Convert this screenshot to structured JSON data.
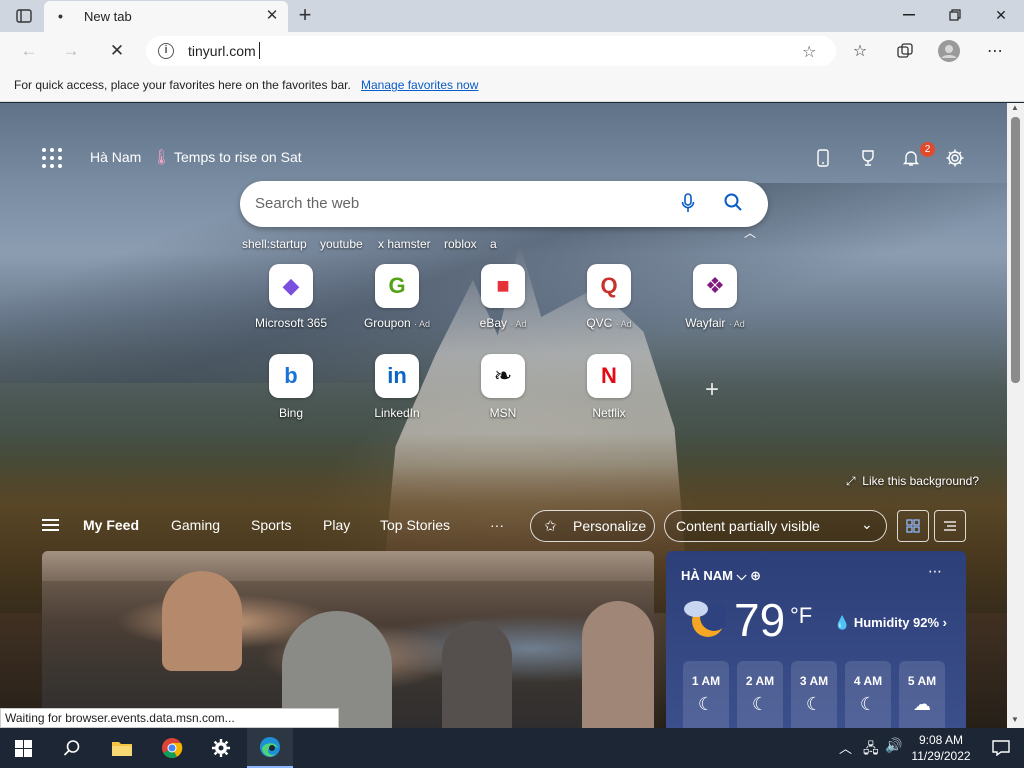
{
  "browser": {
    "tab_title": "New tab",
    "tab_favicon": "•",
    "new_tab_symbol": "+",
    "window_controls": [
      "minimize",
      "restore",
      "close"
    ],
    "url": "tinyurl.com",
    "favorites_bar": {
      "message": "For quick access, place your favorites here on the favorites bar.",
      "link": "Manage favorites now"
    },
    "status": "Waiting for browser.events.data.msn.com..."
  },
  "newtab": {
    "location": "Hà Nam",
    "weather_alert": "Temps to rise on Sat",
    "notification_count": "2",
    "search_placeholder": "Search the web",
    "suggestions": [
      "shell:startup",
      "youtube",
      "x hamster",
      "roblox",
      "a"
    ],
    "tiles": [
      {
        "name": "Microsoft 365",
        "ad": "",
        "glyph": "◆",
        "color": "#7a4fe0"
      },
      {
        "name": "Groupon",
        "ad": "· Ad",
        "glyph": "G",
        "color": "#53a318"
      },
      {
        "name": "eBay",
        "ad": "· Ad",
        "glyph": "■",
        "color": "#e53238"
      },
      {
        "name": "QVC",
        "ad": "· Ad",
        "glyph": "Q",
        "color": "#c7332b"
      },
      {
        "name": "Wayfair",
        "ad": "· Ad",
        "glyph": "❖",
        "color": "#7f187f"
      },
      {
        "name": "Bing",
        "ad": "",
        "glyph": "b",
        "color": "#1b71d8"
      },
      {
        "name": "LinkedIn",
        "ad": "",
        "glyph": "in",
        "color": "#0a66c2"
      },
      {
        "name": "MSN",
        "ad": "",
        "glyph": "❧",
        "color": "#111111"
      },
      {
        "name": "Netflix",
        "ad": "",
        "glyph": "N",
        "color": "#e50914"
      }
    ],
    "add_tile": "+",
    "like_background": "Like this background?"
  },
  "feed": {
    "nav": [
      "My Feed",
      "Gaming",
      "Sports",
      "Play",
      "Top Stories"
    ],
    "more": "···",
    "personalize": "Personalize",
    "content_visibility": "Content partially visible"
  },
  "weather": {
    "location": "HÀ NAM",
    "temperature": "79",
    "unit": "°F",
    "humidity": "Humidity 92%",
    "hours": [
      "1 AM",
      "2 AM",
      "3 AM",
      "4 AM",
      "5 AM"
    ]
  },
  "taskbar": {
    "time": "9:08 AM",
    "date": "11/29/2022"
  }
}
